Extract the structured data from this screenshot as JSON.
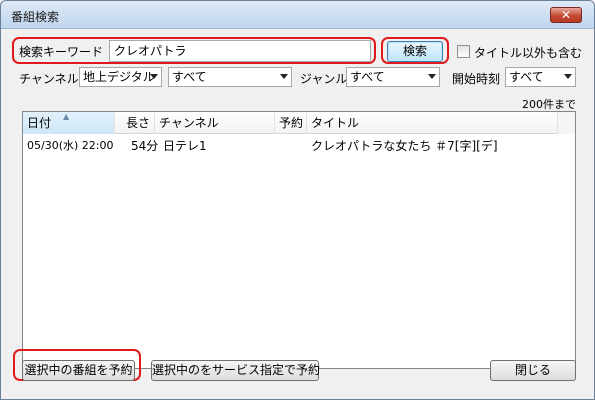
{
  "window": {
    "title": "番組検索"
  },
  "search": {
    "keyword_label": "検索キーワード",
    "keyword_value": "クレオパトラ",
    "search_button": "検索",
    "include_non_title_label": "タイトル以外も含む"
  },
  "filters": {
    "channel_label": "チャンネル",
    "channel_type_value": "地上デジタル",
    "channel_value": "すべて",
    "genre_label": "ジャンル",
    "genre_value": "すべて",
    "start_time_label": "開始時刻",
    "start_time_value": "すべて"
  },
  "results": {
    "limit_text": "200件まで",
    "columns": [
      "日付",
      "長さ",
      "チャンネル",
      "予約",
      "タイトル"
    ],
    "rows": [
      {
        "date": "05/30(水) 22:00",
        "length": "54分",
        "channel": "日テレ1",
        "reserve": "",
        "title": "クレオパトラな女たち ＃7[字][デ]"
      }
    ]
  },
  "footer": {
    "reserve_selected": "選択中の番組を予約",
    "reserve_service": "選択中のをサービス指定で予約",
    "close": "閉じる"
  },
  "icons": {
    "close": "close-icon",
    "sort": "sort-ascending-icon",
    "dropdown": "chevron-down-icon"
  }
}
